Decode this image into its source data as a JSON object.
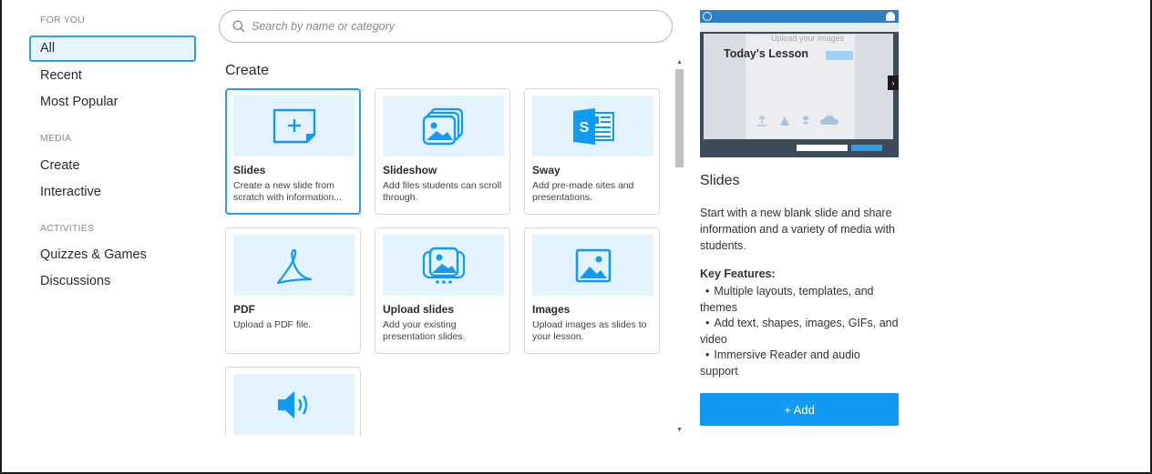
{
  "search": {
    "placeholder": "Search by name or category"
  },
  "sidebar": {
    "sections": [
      {
        "title": "FOR YOU",
        "items": [
          "All",
          "Recent",
          "Most Popular"
        ]
      },
      {
        "title": "MEDIA",
        "items": [
          "Create",
          "Interactive"
        ]
      },
      {
        "title": "ACTIVITIES",
        "items": [
          "Quizzes & Games",
          "Discussions"
        ]
      }
    ],
    "active_item": "All"
  },
  "main": {
    "section_title": "Create",
    "cards": [
      {
        "title": "Slides",
        "description": "Create a new slide from scratch with information...",
        "icon": "new-slide-icon",
        "selected": true
      },
      {
        "title": "Slideshow",
        "description": "Add files students can scroll through.",
        "icon": "slideshow-icon"
      },
      {
        "title": "Sway",
        "description": "Add pre-made sites and presentations.",
        "icon": "sway-icon"
      },
      {
        "title": "PDF",
        "description": "Upload a PDF file.",
        "icon": "pdf-icon"
      },
      {
        "title": "Upload slides",
        "description": "Add your existing presentation slides.",
        "icon": "upload-slides-icon"
      },
      {
        "title": "Images",
        "description": "Upload images as slides to your lesson.",
        "icon": "image-icon"
      },
      {
        "title": "",
        "description": "",
        "icon": "audio-icon"
      }
    ]
  },
  "detail": {
    "preview": {
      "lesson_title": "Today's Lesson",
      "upload_text": "Upload your images"
    },
    "title": "Slides",
    "description": "Start with a new blank slide and share information and a variety of media with students.",
    "key_features_heading": "Key Features:",
    "key_features": [
      "Multiple layouts, templates, and themes",
      "Add text, shapes, images, GIFs, and video",
      "Immersive Reader and audio support"
    ],
    "add_label": "+ Add"
  },
  "colors": {
    "accent": "#109af4",
    "selected_border": "#2d9ee8",
    "thumb_bg": "#e3f3fd"
  }
}
